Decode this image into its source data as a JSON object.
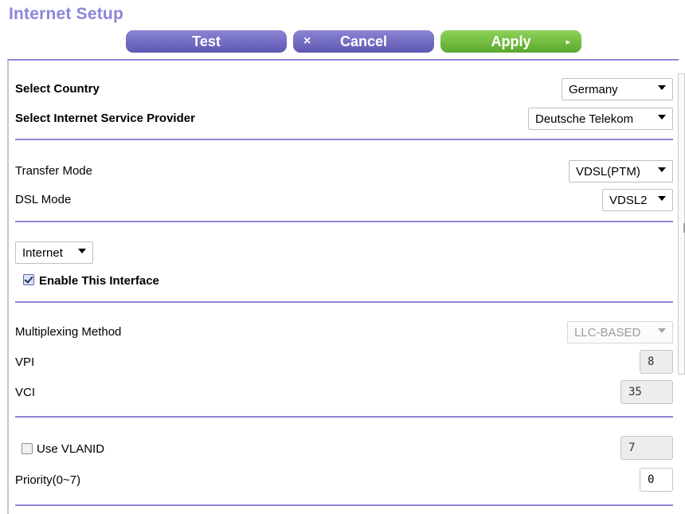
{
  "header": {
    "title": "Internet Setup"
  },
  "toolbar": {
    "test_label": "Test",
    "cancel_label": "Cancel",
    "cancel_icon": "×",
    "apply_label": "Apply",
    "apply_icon": "▸"
  },
  "country": {
    "label": "Select Country",
    "value": "Germany"
  },
  "isp": {
    "label": "Select Internet Service Provider",
    "value": "Deutsche Telekom"
  },
  "transfer_mode": {
    "label": "Transfer Mode",
    "value": "VDSL(PTM)"
  },
  "dsl_mode": {
    "label": "DSL Mode",
    "value": "VDSL2"
  },
  "interface": {
    "value": "Internet",
    "enable_label": "Enable This Interface",
    "enabled": true
  },
  "multiplexing": {
    "label": "Multiplexing Method",
    "value": "LLC-BASED"
  },
  "vpi": {
    "label": "VPI",
    "value": "8"
  },
  "vci": {
    "label": "VCI",
    "value": "35"
  },
  "vlan": {
    "label": "Use VLANID",
    "checked": false,
    "value": "7"
  },
  "priority": {
    "label": "Priority(0~7)",
    "value": "0"
  },
  "colors": {
    "accent": "#8b86d9",
    "button_purple": "#6f69c4",
    "button_green": "#6fbc3c"
  }
}
